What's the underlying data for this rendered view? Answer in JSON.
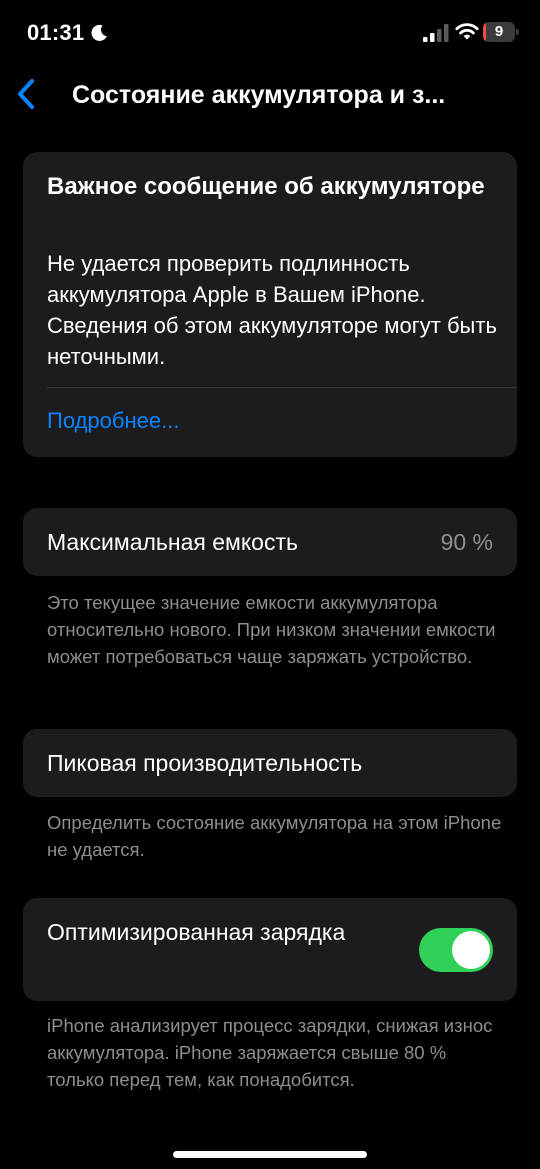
{
  "status_bar": {
    "time": "01:31",
    "battery_level": "9",
    "battery_fraction": 0.09,
    "moon_icon": "moon-icon",
    "signal_icon": "cellular-signal-icon",
    "wifi_icon": "wifi-icon",
    "battery_icon": "battery-icon"
  },
  "nav": {
    "back_icon": "chevron-left-icon",
    "title": "Состояние аккумулятора и з..."
  },
  "alert": {
    "title": "Важное сообщение об аккумуляторе",
    "body": "Не удается проверить подлинность аккумулятора Apple в Вашем iPhone. Сведения об этом аккумуляторе могут быть неточными.",
    "link": "Подробнее..."
  },
  "capacity": {
    "label": "Максимальная емкость",
    "value": "90 %",
    "footnote": "Это текущее значение емкости аккумулятора относительно нового. При низком значении емкости может потребоваться чаще заряжать устройство."
  },
  "peak": {
    "label": "Пиковая производительность",
    "footnote": "Определить состояние аккумулятора на этом iPhone не удается."
  },
  "charging": {
    "label": "Оптимизированная зарядка",
    "enabled": true,
    "footnote": "iPhone анализирует процесс зарядки, снижая износ аккумулятора. iPhone заряжается свыше 80 % только перед тем, как понадобится."
  },
  "colors": {
    "background": "#000000",
    "card": "#1c1c1e",
    "accent_link": "#0a84ff",
    "toggle_on": "#30d158",
    "battery_low": "#eb4e3d",
    "secondary_text": "#8d8d92"
  }
}
